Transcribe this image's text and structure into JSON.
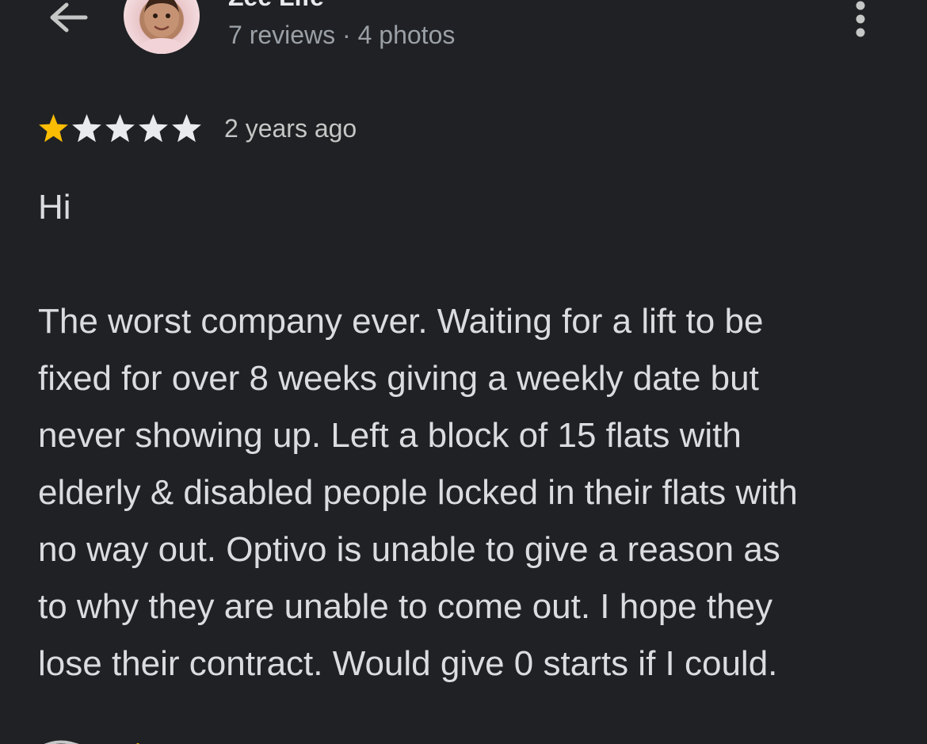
{
  "header": {
    "back_icon": "arrow-back-icon",
    "avatar_icon": "profile-photo",
    "user_name": "Zee Life",
    "user_meta": "7 reviews · 4 photos",
    "more_icon": "more-vert-icon"
  },
  "review": {
    "rating": 1,
    "max_rating": 5,
    "star_filled_color": "#fbbc04",
    "star_empty_color": "#e8eaed",
    "date": "2 years ago",
    "text": "Hi\n\nThe worst company ever. Waiting for a lift to be\nfixed for over 8 weeks giving a weekly date but\nnever showing up. Left a block of 15 flats with\nelderly & disabled people locked in their flats with\nno way out. Optivo is unable to give a reason as\nto why they are unable to come out. I hope they\nlose their contract. Would give 0 starts if I could."
  },
  "colors": {
    "background": "#202124",
    "text_primary": "#e8eaed",
    "text_secondary": "#9aa0a6"
  }
}
